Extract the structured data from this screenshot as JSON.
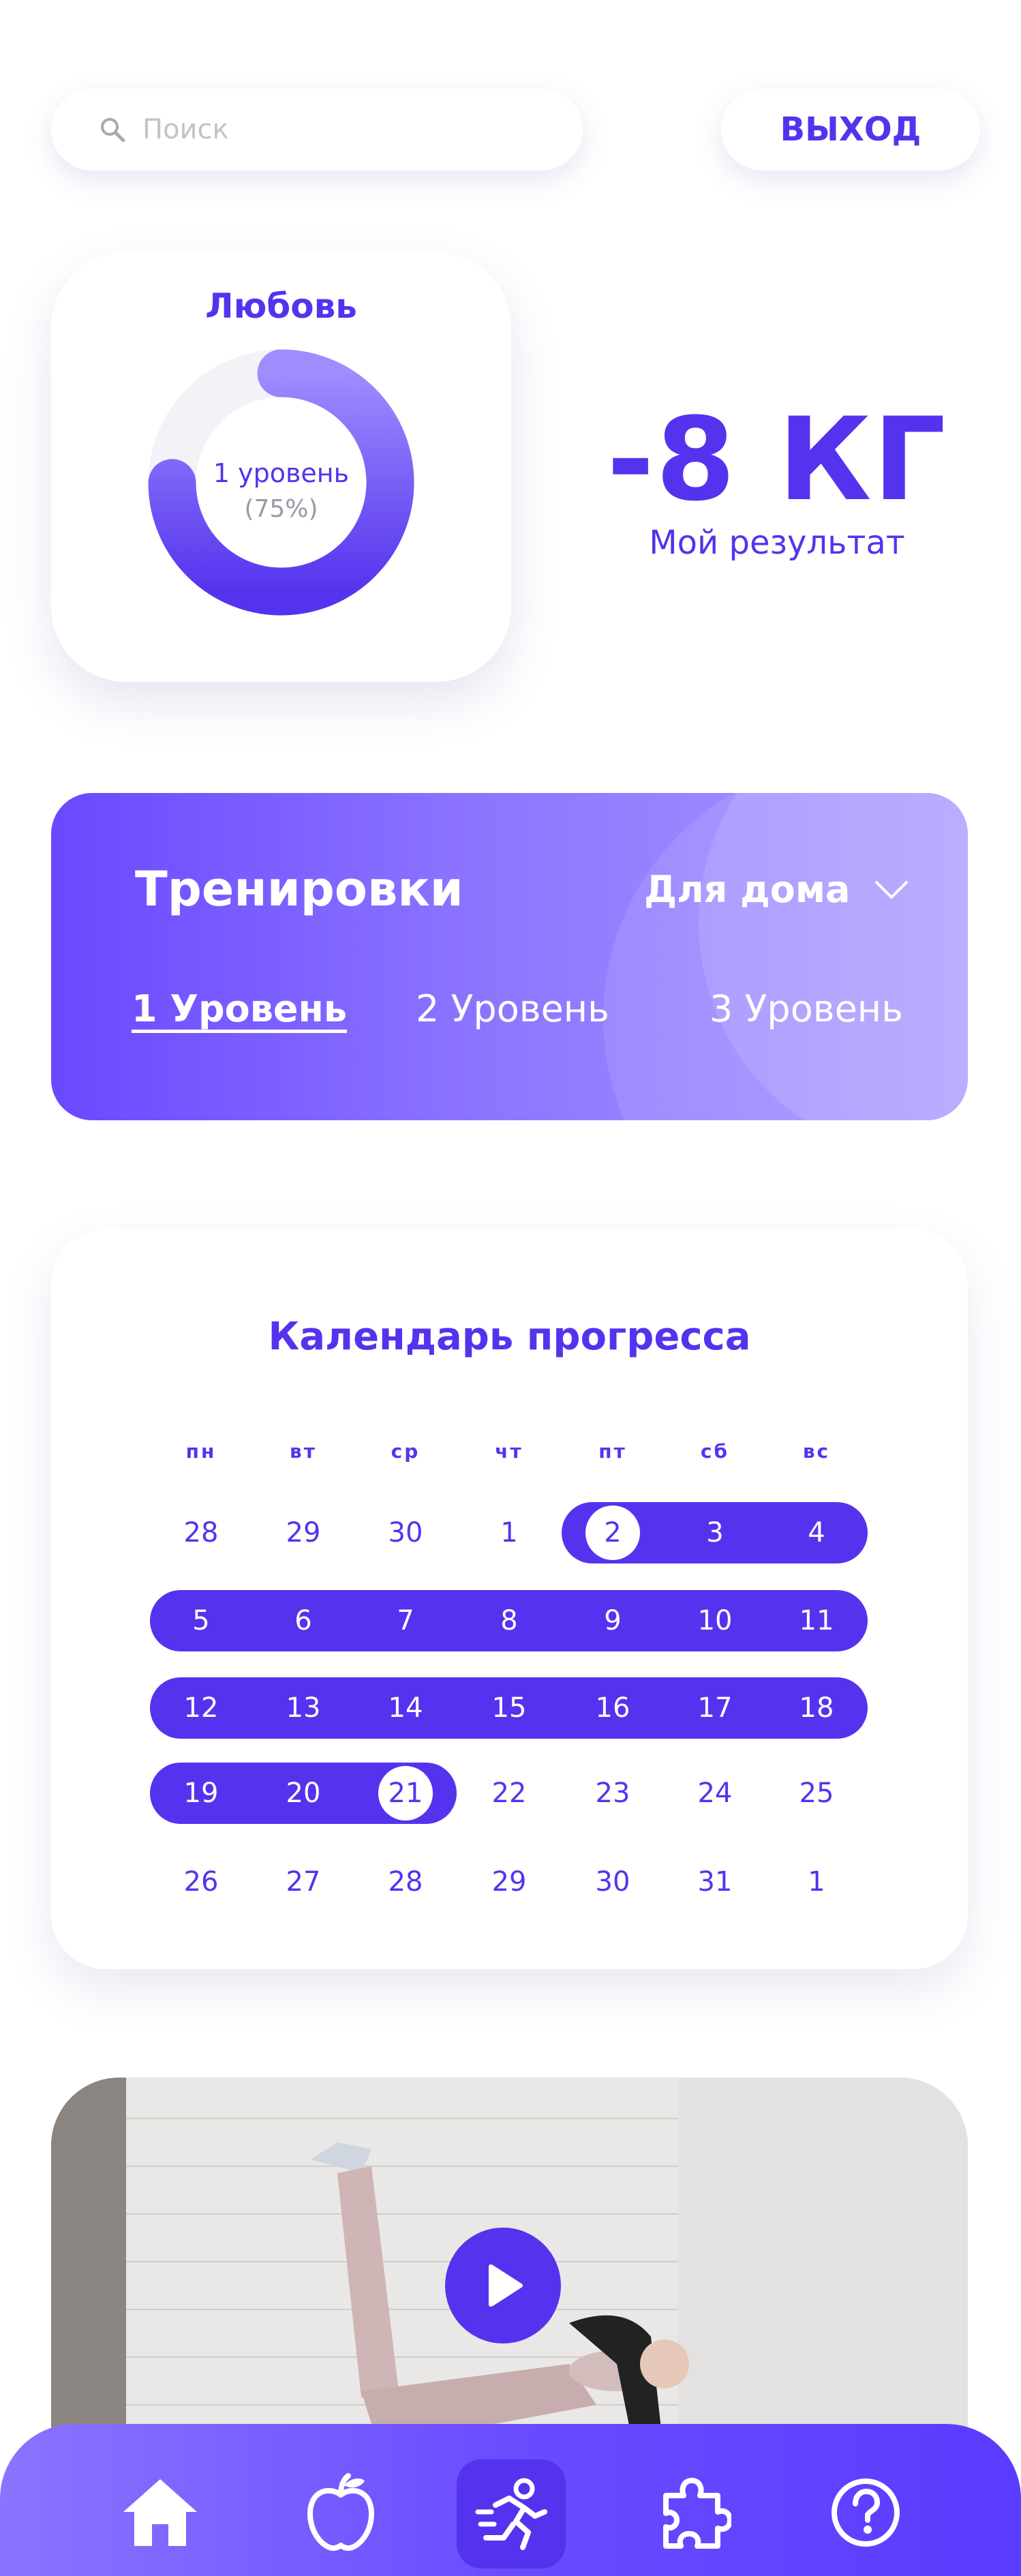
{
  "search": {
    "placeholder": "Поиск"
  },
  "header": {
    "logout_label": "ВЫХОД"
  },
  "profile": {
    "name": "Любовь",
    "level_label": "1 уровень",
    "progress_label": "(75%)",
    "progress_fraction": 0.75
  },
  "result": {
    "value": "-8 КГ",
    "caption": "Мой результат"
  },
  "trainings": {
    "title": "Тренировки",
    "filter_value": "Для дома",
    "levels": [
      {
        "label": "1 Уровень",
        "active": true
      },
      {
        "label": "2 Уровень",
        "active": false
      },
      {
        "label": "3 Уровень",
        "active": false
      }
    ]
  },
  "calendar": {
    "title": "Календарь прогресса",
    "weekdays": [
      "пн",
      "вт",
      "ср",
      "чт",
      "пт",
      "сб",
      "вс"
    ],
    "weeks": [
      [
        "28",
        "29",
        "30",
        "1",
        "2",
        "3",
        "4"
      ],
      [
        "5",
        "6",
        "7",
        "8",
        "9",
        "10",
        "11"
      ],
      [
        "12",
        "13",
        "14",
        "15",
        "16",
        "17",
        "18"
      ],
      [
        "19",
        "20",
        "21",
        "22",
        "23",
        "24",
        "25"
      ],
      [
        "26",
        "27",
        "28",
        "29",
        "30",
        "31",
        "1"
      ]
    ],
    "progress_start": "2",
    "progress_end": "21"
  },
  "nav": {
    "items": [
      "home-icon",
      "apple-icon",
      "running-icon",
      "puzzle-icon",
      "help-icon"
    ],
    "active": "running-icon"
  },
  "colors": {
    "accent": "#5533ee",
    "gradient_start": "#6a48ff",
    "gradient_end": "#aa98ff",
    "track": "#f2f3f7"
  }
}
